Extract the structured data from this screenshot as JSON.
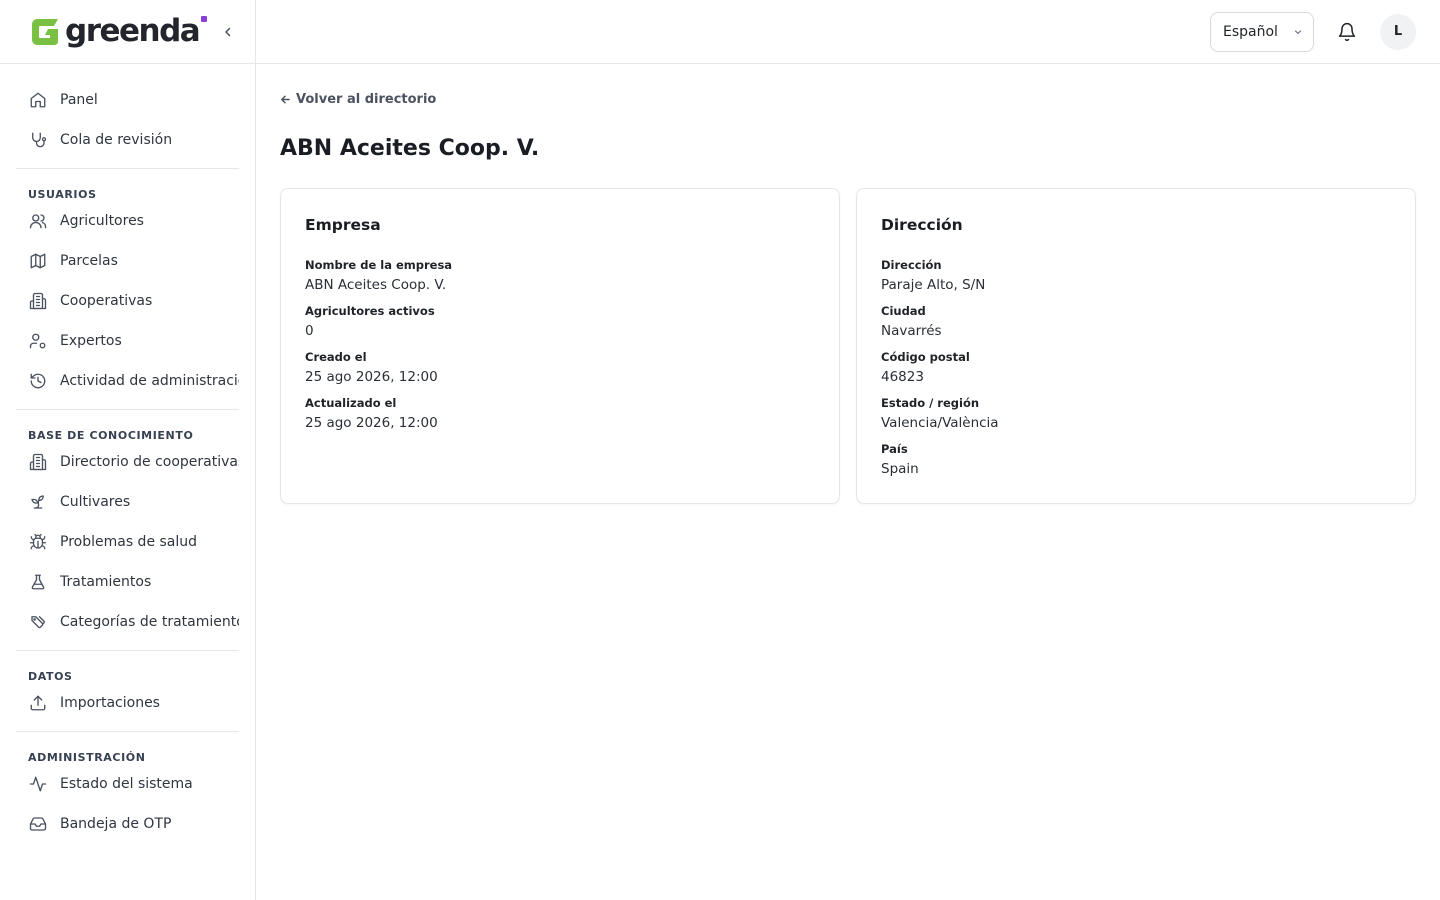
{
  "brand": {
    "name": "greenda",
    "accent": "#8b3fd9",
    "green": "#7ac143"
  },
  "sidebar": {
    "groups": [
      {
        "title": "",
        "items": [
          {
            "label": "Panel",
            "icon": "home-icon"
          },
          {
            "label": "Cola de revisión",
            "icon": "stethoscope-icon"
          }
        ]
      },
      {
        "title": "USUARIOS",
        "items": [
          {
            "label": "Agricultores",
            "icon": "users-icon"
          },
          {
            "label": "Parcelas",
            "icon": "map-icon"
          },
          {
            "label": "Cooperativas",
            "icon": "building-icon"
          },
          {
            "label": "Expertos",
            "icon": "user-cog-icon"
          },
          {
            "label": "Actividad de administración",
            "icon": "history-icon"
          }
        ]
      },
      {
        "title": "BASE DE CONOCIMIENTO",
        "items": [
          {
            "label": "Directorio de cooperativas",
            "icon": "building-icon"
          },
          {
            "label": "Cultivares",
            "icon": "sprout-icon"
          },
          {
            "label": "Problemas de salud",
            "icon": "bug-icon"
          },
          {
            "label": "Tratamientos",
            "icon": "flask-icon"
          },
          {
            "label": "Categorías de tratamiento",
            "icon": "tag-icon"
          }
        ]
      },
      {
        "title": "DATOS",
        "items": [
          {
            "label": "Importaciones",
            "icon": "upload-icon"
          }
        ]
      },
      {
        "title": "ADMINISTRACIÓN",
        "items": [
          {
            "label": "Estado del sistema",
            "icon": "activity-icon"
          },
          {
            "label": "Bandeja de OTP",
            "icon": "inbox-icon"
          }
        ]
      }
    ]
  },
  "topbar": {
    "language": "Español",
    "avatar_initial": "L"
  },
  "page": {
    "back_label": "Volver al directorio",
    "title": "ABN Aceites Coop. V."
  },
  "company_card": {
    "title": "Empresa",
    "fields": [
      {
        "label": "Nombre de la empresa",
        "value": "ABN Aceites Coop. V."
      },
      {
        "label": "Agricultores activos",
        "value": "0"
      },
      {
        "label": "Creado el",
        "value": "25 ago 2026, 12:00"
      },
      {
        "label": "Actualizado el",
        "value": "25 ago 2026, 12:00"
      }
    ]
  },
  "address_card": {
    "title": "Dirección",
    "fields": [
      {
        "label": "Dirección",
        "value": "Paraje Alto, S/N"
      },
      {
        "label": "Ciudad",
        "value": "Navarrés"
      },
      {
        "label": "Código postal",
        "value": "46823"
      },
      {
        "label": "Estado / región",
        "value": "Valencia/València"
      },
      {
        "label": "País",
        "value": "Spain"
      }
    ]
  }
}
